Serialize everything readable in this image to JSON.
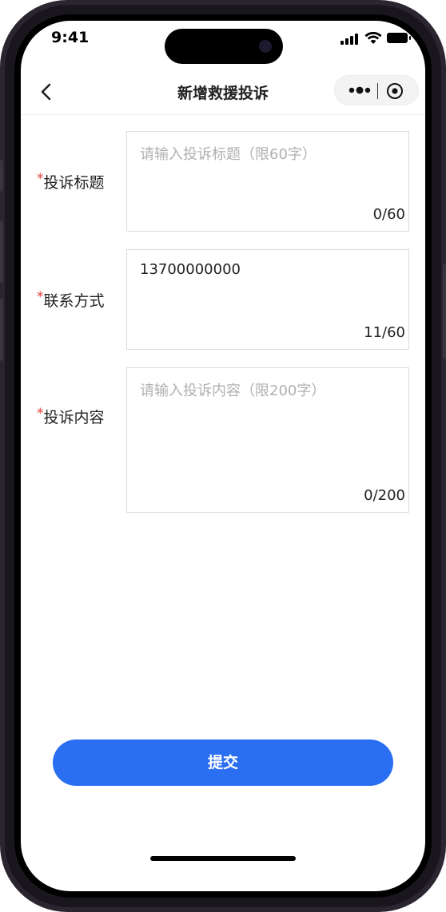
{
  "status_bar": {
    "time": "9:41"
  },
  "nav": {
    "title": "新增救援投诉"
  },
  "form": {
    "title_field": {
      "label": "投诉标题",
      "required_mark": "*",
      "placeholder": "请输入投诉标题（限60字）",
      "value": "",
      "counter": "0/60"
    },
    "contact_field": {
      "label": "联系方式",
      "required_mark": "*",
      "placeholder": "",
      "value": "13700000000",
      "counter": "11/60"
    },
    "content_field": {
      "label": "投诉内容",
      "required_mark": "*",
      "placeholder": "请输入投诉内容（限200字）",
      "value": "",
      "counter": "0/200"
    }
  },
  "submit": {
    "label": "提交"
  },
  "colors": {
    "accent": "#2a6ef2",
    "required": "#e53935",
    "border": "#dcdcdc"
  }
}
